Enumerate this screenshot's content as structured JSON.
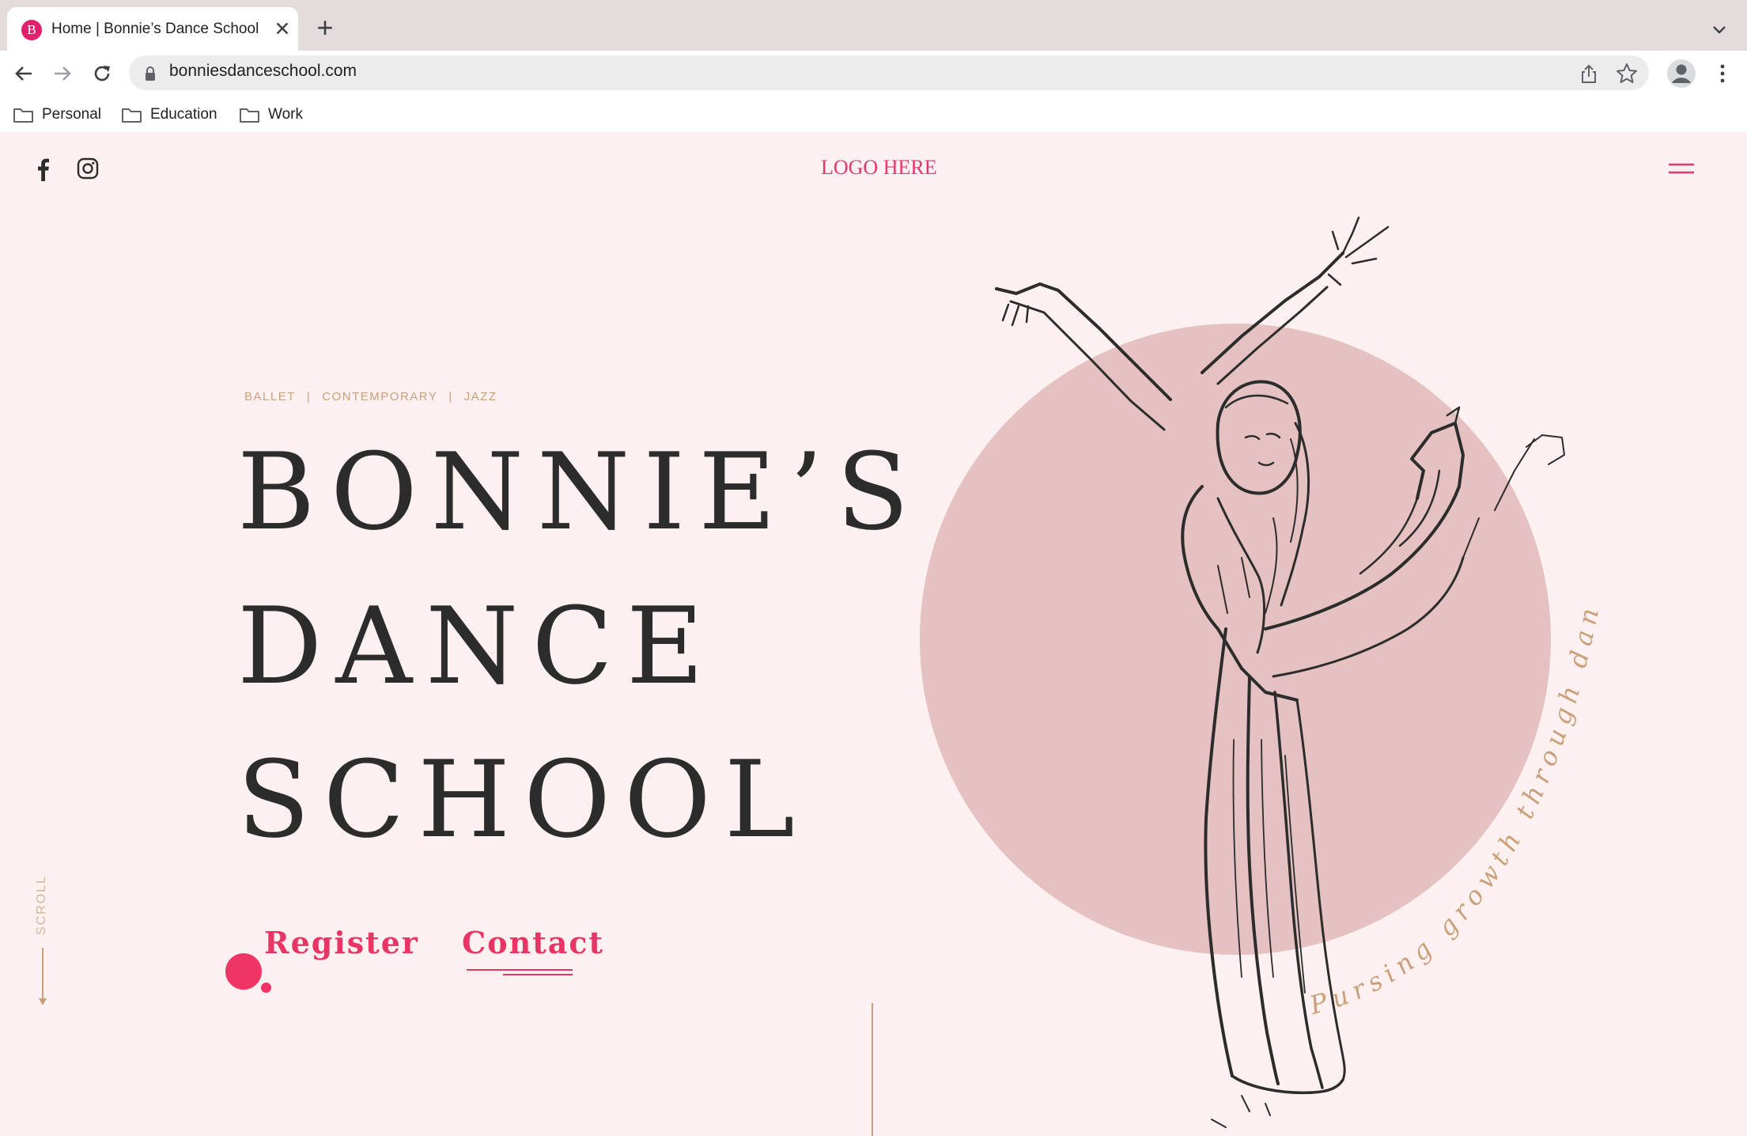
{
  "browser": {
    "tab_title": "Home | Bonnie’s Dance School",
    "tab_favicon_letter": "B",
    "tab_close": "✕",
    "new_tab": "+",
    "url": "bonniesdanceschool.com",
    "bookmarks": [
      {
        "label": "Personal",
        "icon": "folder-icon"
      },
      {
        "label": "Education",
        "icon": "folder-icon"
      },
      {
        "label": "Work",
        "icon": "folder-icon"
      }
    ],
    "colors": {
      "tabstrip": "#e4dcdc",
      "omnibox": "#ececec",
      "favicon": "#e3206c"
    }
  },
  "page": {
    "logo": "LOGO HERE",
    "tagline": [
      "BALLET",
      "CONTEMPORARY",
      "JAZZ"
    ],
    "tagline_separator": "|",
    "hero_lines": [
      "BONNIE’S",
      "DANCE",
      "SCHOOL"
    ],
    "register_label": "Register",
    "contact_label": "Contact",
    "scroll_label": "SCROLL",
    "arc_text": "Pursing growth through dance",
    "colors": {
      "background": "#fdf0f0",
      "accent": "#e83565",
      "circle": "#e5c1c1",
      "gold": "#c9a07a",
      "text": "#2d2c2c"
    }
  }
}
